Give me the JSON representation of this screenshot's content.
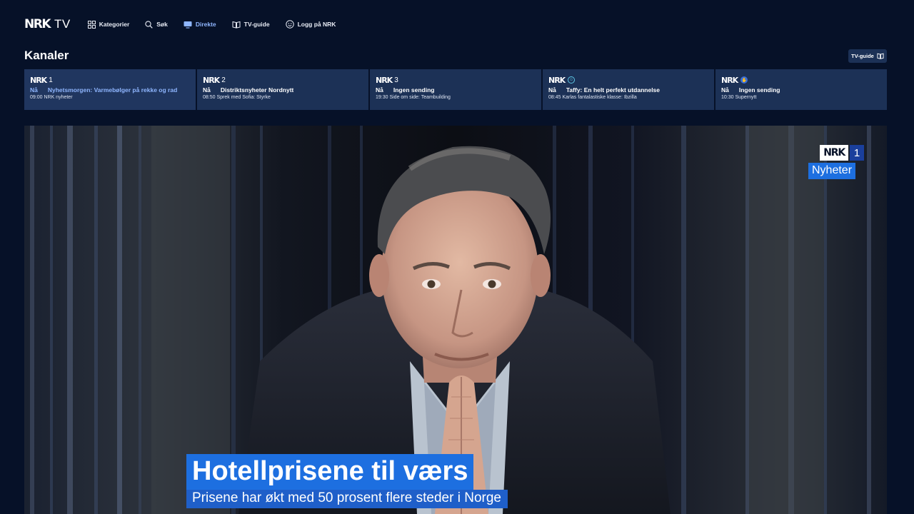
{
  "app": {
    "logo_mark": "NRK",
    "logo_suffix": "TV"
  },
  "nav": {
    "items": [
      {
        "label": "Kategorier",
        "icon": "grid-icon",
        "active": false
      },
      {
        "label": "Søk",
        "icon": "search-icon",
        "active": false
      },
      {
        "label": "Direkte",
        "icon": "live-tv-icon",
        "active": true
      },
      {
        "label": "TV-guide",
        "icon": "book-icon",
        "active": false
      },
      {
        "label": "Logg på NRK",
        "icon": "user-icon",
        "active": false
      }
    ]
  },
  "section": {
    "title": "Kanaler",
    "tvguide_button": "TV-guide"
  },
  "channels": [
    {
      "logo": "NRK",
      "number": "1",
      "badge": "",
      "now_prefix": "Nå",
      "now_title": "Nyhetsmorgen: Varmebølger på rekke og rad",
      "next": "09:00 NRK nyheter"
    },
    {
      "logo": "NRK",
      "number": "2",
      "badge": "",
      "now_prefix": "Nå",
      "now_title": "Distriktsnyheter Nordnytt",
      "next": "08:50 Sprek med Sofia: Styrke"
    },
    {
      "logo": "NRK",
      "number": "3",
      "badge": "",
      "now_prefix": "Nå",
      "now_title": "Ingen sending",
      "next": "19:30 Side om side: Teambuilding"
    },
    {
      "logo": "NRK",
      "number": "",
      "badge": "super",
      "now_prefix": "Nå",
      "now_title": "Taffy: En helt perfekt utdannelse",
      "next": "08:45 Karlas fantalastiske klasse: Ibzilla"
    },
    {
      "logo": "NRK",
      "number": "",
      "badge": "tegn",
      "now_prefix": "Nå",
      "now_title": "Ingen sending",
      "next": "10:30 Supernytt"
    }
  ],
  "player": {
    "channel_mark": "NRK",
    "channel_number": "1",
    "channel_label": "Nyheter",
    "headline": "Hotellprisene til værs",
    "subline": "Prisene har økt med 50 prosent flere steder i Norge"
  },
  "colors": {
    "background": "#061128",
    "card": "#1c3156",
    "active_nav": "#8fb6ff",
    "lower_third": "#1d6fe0"
  }
}
